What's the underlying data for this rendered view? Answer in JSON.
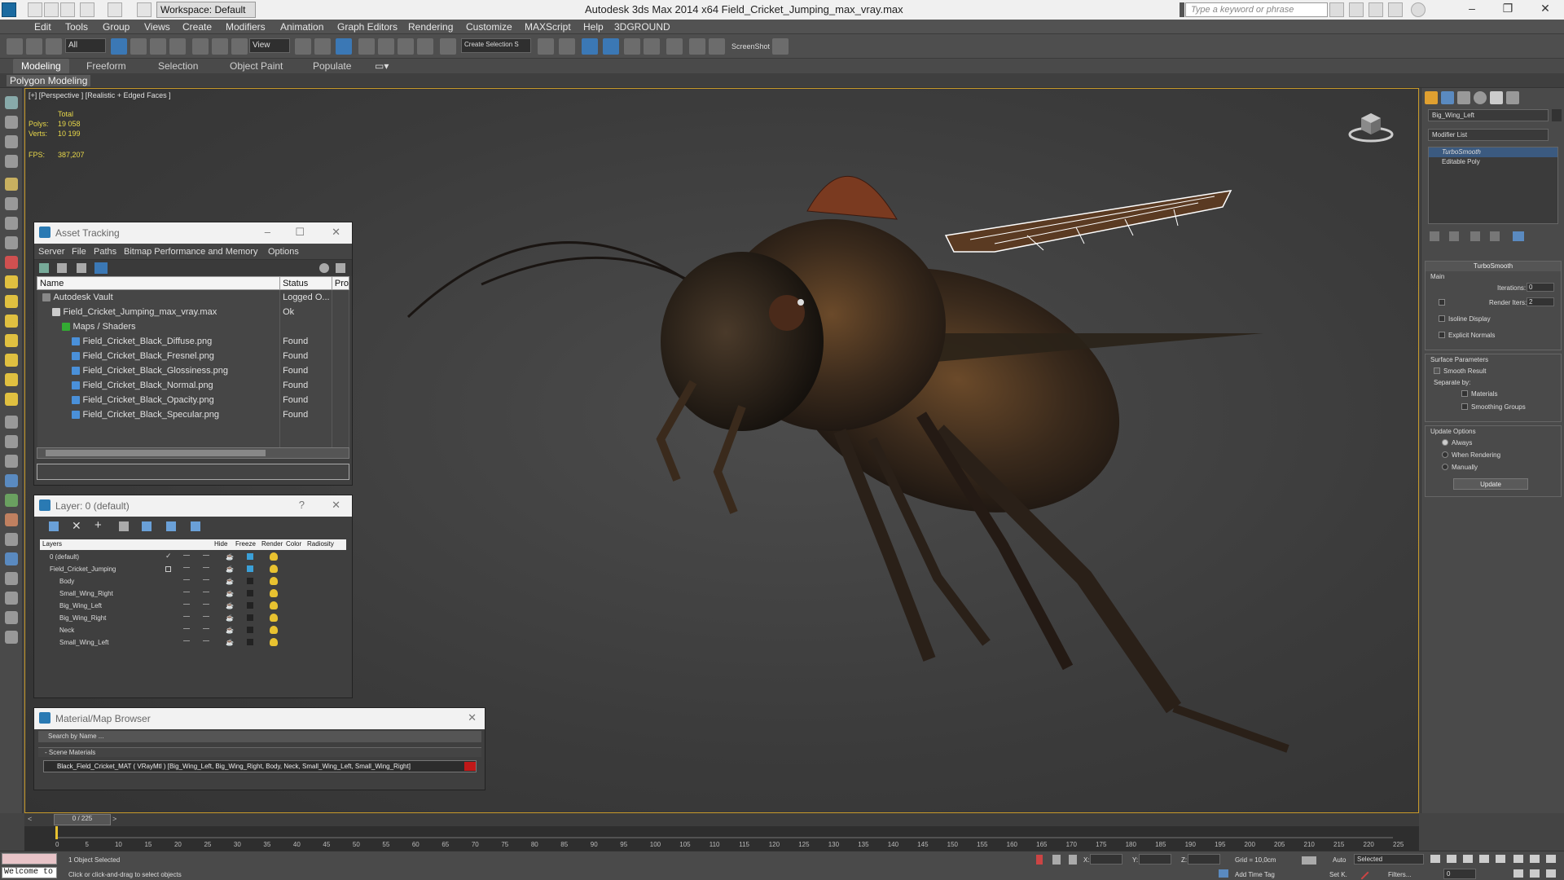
{
  "titlebar": {
    "workspace": "Workspace: Default",
    "title": "Autodesk 3ds Max  2014 x64      Field_Cricket_Jumping_max_vray.max",
    "search_placeholder": "Type a keyword or phrase"
  },
  "menu": [
    "Edit",
    "Tools",
    "Group",
    "Views",
    "Create",
    "Modifiers",
    "Animation",
    "Graph Editors",
    "Rendering",
    "Customize",
    "MAXScript",
    "Help",
    "3DGROUND"
  ],
  "toolbar": {
    "filter": "All",
    "ref_coord": "View",
    "named_selection": "Create Selection S",
    "screenshot": "ScreenShot"
  },
  "ribbon": {
    "tabs": [
      "Modeling",
      "Freeform",
      "Selection",
      "Object Paint",
      "Populate"
    ],
    "panel_label": "Polygon Modeling"
  },
  "viewport": {
    "label": "[+] [Perspective ] [Realistic + Edged Faces ]",
    "stats_header": "Total",
    "polys_label": "Polys:",
    "polys_value": "19 058",
    "verts_label": "Verts:",
    "verts_value": "10 199",
    "fps_label": "FPS:",
    "fps_value": "387,207"
  },
  "asset_tracking": {
    "title": "Asset Tracking",
    "menus": [
      "Server",
      "File",
      "Paths",
      "Bitmap Performance and Memory",
      "Options"
    ],
    "columns": [
      "Name",
      "Status",
      "Pro"
    ],
    "rows": [
      {
        "name": "Autodesk Vault",
        "status": "Logged O...",
        "indent": 0
      },
      {
        "name": "Field_Cricket_Jumping_max_vray.max",
        "status": "Ok",
        "indent": 1
      },
      {
        "name": "Maps / Shaders",
        "status": "",
        "indent": 2
      },
      {
        "name": "Field_Cricket_Black_Diffuse.png",
        "status": "Found",
        "indent": 3
      },
      {
        "name": "Field_Cricket_Black_Fresnel.png",
        "status": "Found",
        "indent": 3
      },
      {
        "name": "Field_Cricket_Black_Glossiness.png",
        "status": "Found",
        "indent": 3
      },
      {
        "name": "Field_Cricket_Black_Normal.png",
        "status": "Found",
        "indent": 3
      },
      {
        "name": "Field_Cricket_Black_Opacity.png",
        "status": "Found",
        "indent": 3
      },
      {
        "name": "Field_Cricket_Black_Specular.png",
        "status": "Found",
        "indent": 3
      }
    ]
  },
  "layer_panel": {
    "title": "Layer: 0 (default)",
    "columns": [
      "Layers",
      "Hide",
      "Freeze",
      "Render",
      "Color",
      "Radiosity"
    ],
    "rows": [
      {
        "name": "0 (default)",
        "color": "#3aa0d8"
      },
      {
        "name": "Field_Cricket_Jumping",
        "color": "#3aa0d8"
      },
      {
        "name": "Body",
        "color": "#222222"
      },
      {
        "name": "Small_Wing_Right",
        "color": "#222222"
      },
      {
        "name": "Big_Wing_Left",
        "color": "#222222"
      },
      {
        "name": "Big_Wing_Right",
        "color": "#222222"
      },
      {
        "name": "Neck",
        "color": "#222222"
      },
      {
        "name": "Small_Wing_Left",
        "color": "#222222"
      }
    ]
  },
  "material_browser": {
    "title": "Material/Map Browser",
    "search_placeholder": "Search by Name ...",
    "section": "- Scene Materials",
    "material": "Black_Field_Cricket_MAT ( VRayMtl ) [Big_Wing_Left, Big_Wing_Right, Body, Neck, Small_Wing_Left, Small_Wing_Right]"
  },
  "command_panel": {
    "object_name": "Big_Wing_Left",
    "modifier_list": "Modifier List",
    "stack": [
      "TurboSmooth",
      "Editable Poly"
    ],
    "turbosmooth": {
      "title": "TurboSmooth",
      "main": "Main",
      "iterations_label": "Iterations:",
      "iterations": "0",
      "render_iters_label": "Render Iters:",
      "render_iters": "2",
      "isoline": "Isoline Display",
      "explicit": "Explicit Normals",
      "surface_params": "Surface Parameters",
      "smooth_result": "Smooth Result",
      "separate_by": "Separate by:",
      "materials": "Materials",
      "smoothing_groups": "Smoothing Groups",
      "update_options": "Update Options",
      "always": "Always",
      "when_rendering": "When Rendering",
      "manually": "Manually",
      "update": "Update"
    }
  },
  "timeline": {
    "frame_display": "0 / 225",
    "ticks": [
      "0",
      "5",
      "10",
      "15",
      "20",
      "25",
      "30",
      "35",
      "40",
      "45",
      "50",
      "55",
      "60",
      "65",
      "70",
      "75",
      "80",
      "85",
      "90",
      "95",
      "100",
      "105",
      "110",
      "115",
      "120",
      "125",
      "130",
      "135",
      "140",
      "145",
      "150",
      "155",
      "160",
      "165",
      "170",
      "175",
      "180",
      "185",
      "190",
      "195",
      "200",
      "205",
      "210",
      "215",
      "220",
      "225"
    ]
  },
  "status": {
    "maxscript": "Welcome to",
    "selected": "1 Object Selected",
    "prompt": "Click or click-and-drag to select objects",
    "x_label": "X:",
    "y_label": "Y:",
    "z_label": "Z:",
    "grid": "Grid = 10,0cm",
    "add_time_tag": "Add Time Tag",
    "auto": "Auto",
    "set_key": "Set K.",
    "key_filter": "Selected",
    "filters": "Filters...",
    "frame": "0"
  }
}
